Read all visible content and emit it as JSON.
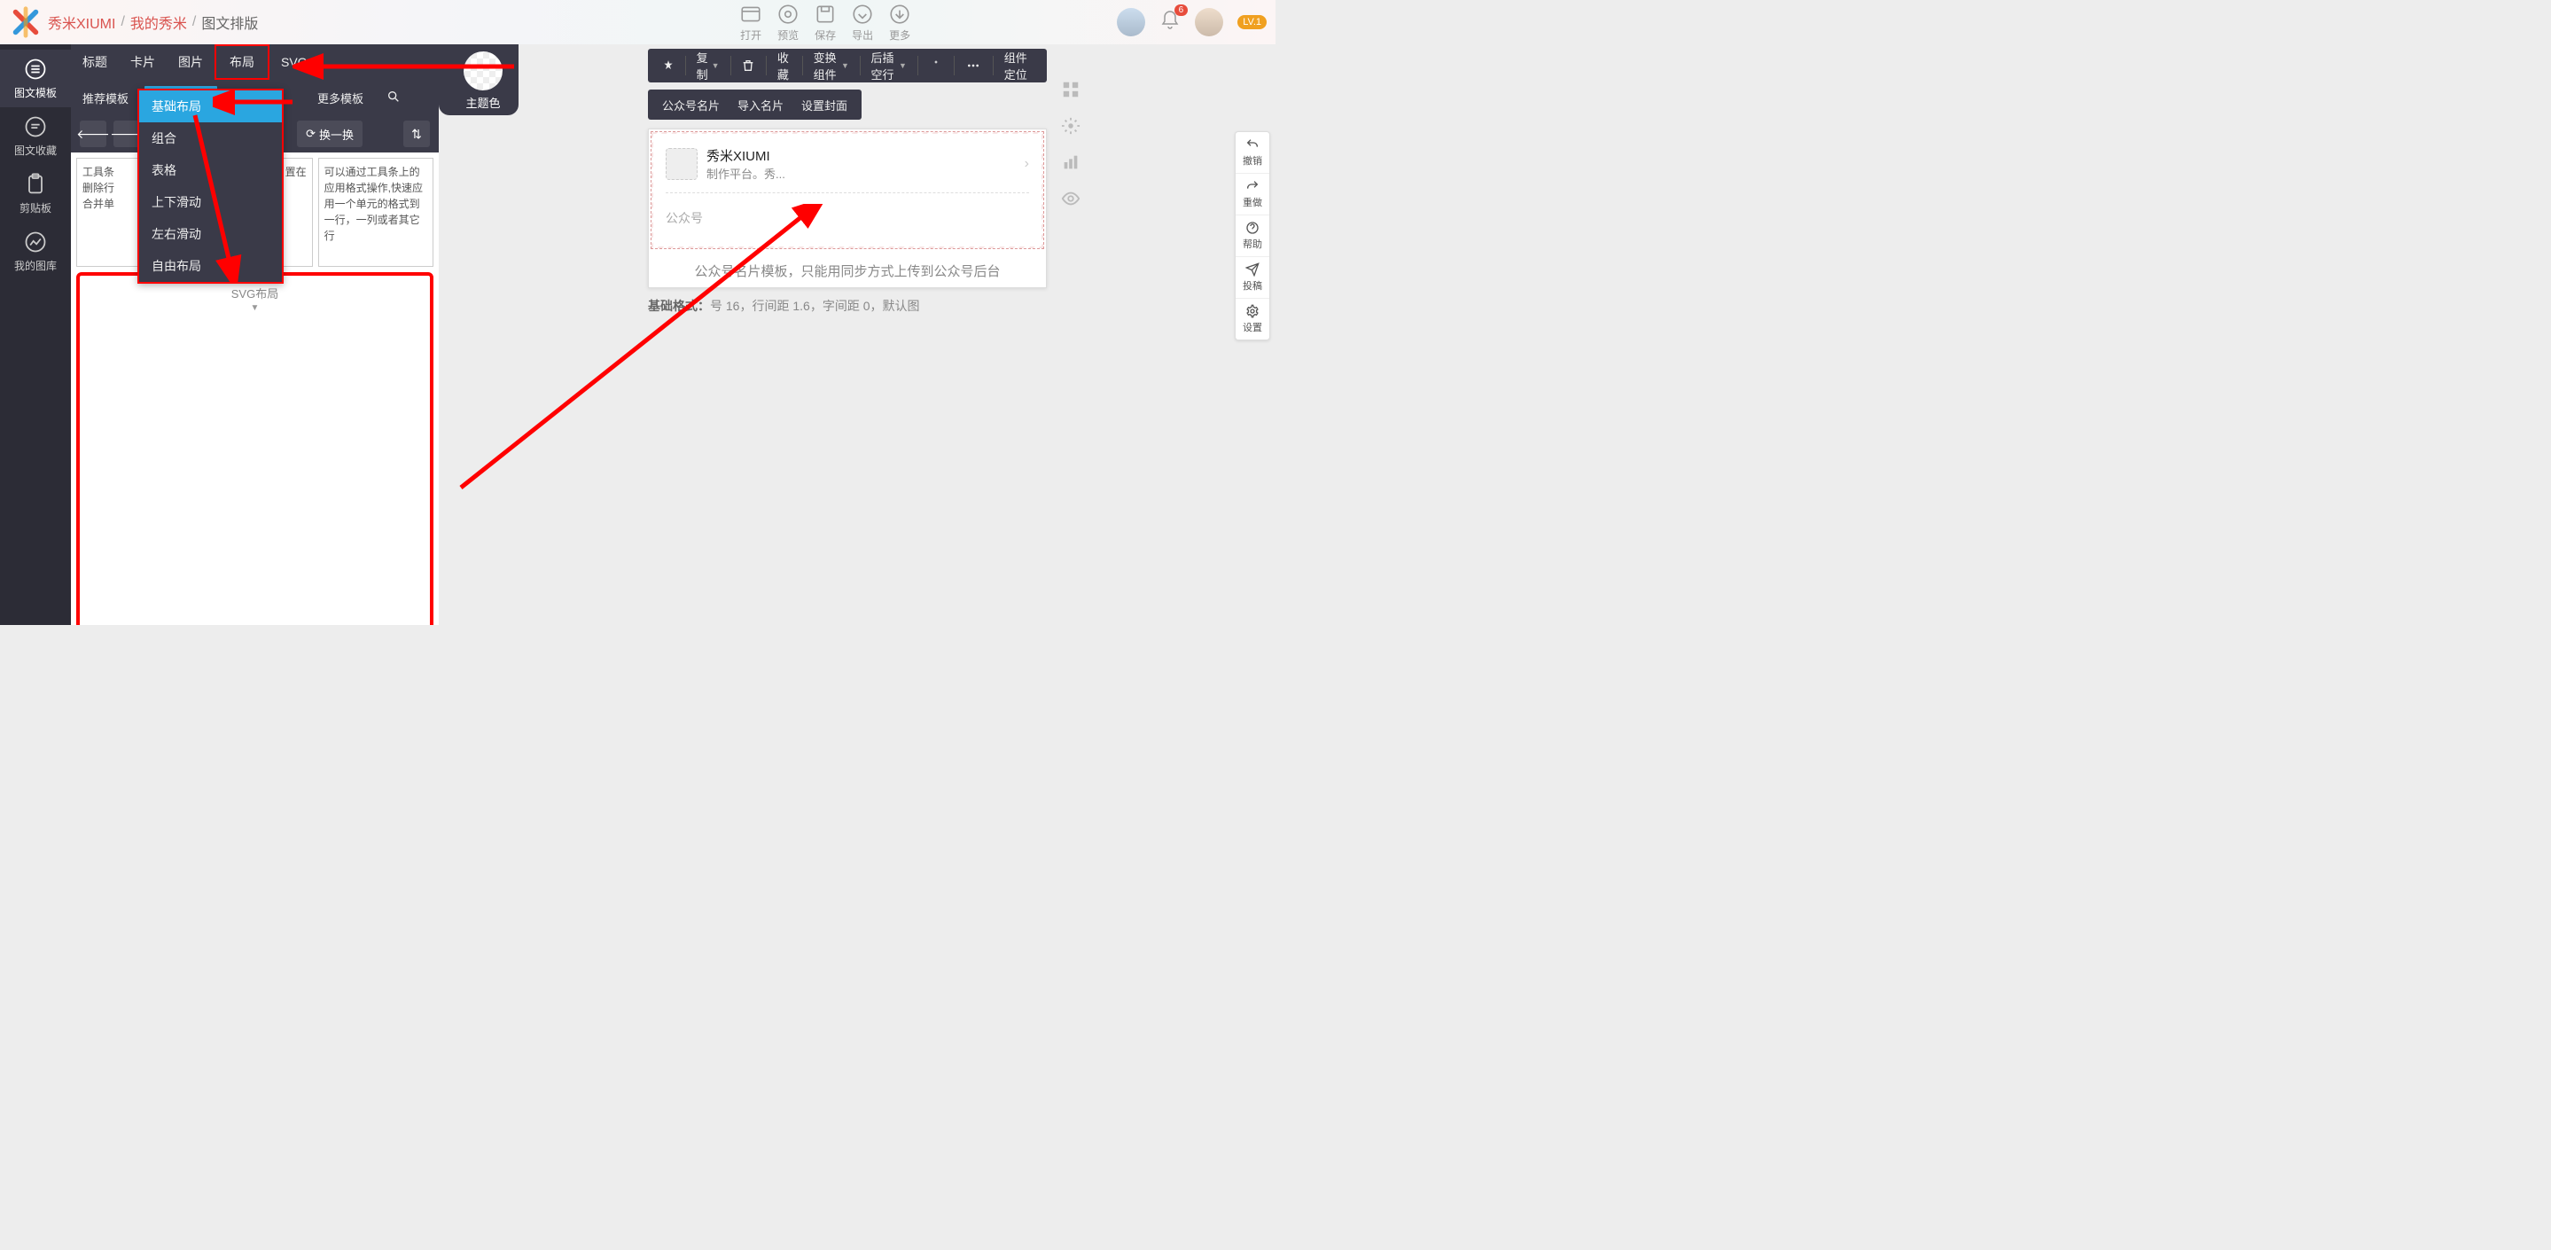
{
  "header": {
    "breadcrumb": [
      "秀米XIUMI",
      "我的秀米",
      "图文排版"
    ],
    "actions": [
      {
        "label": "打开"
      },
      {
        "label": "预览"
      },
      {
        "label": "保存"
      },
      {
        "label": "导出"
      },
      {
        "label": "更多"
      }
    ],
    "badge_count": "6",
    "level": "LV.1"
  },
  "sidebar": [
    {
      "label": "图文模板",
      "active": true
    },
    {
      "label": "图文收藏"
    },
    {
      "label": "剪贴板"
    },
    {
      "label": "我的图库"
    }
  ],
  "tabs_row1": [
    "标题",
    "卡片",
    "图片",
    "布局",
    "SVG"
  ],
  "tabs_row2": [
    "推荐模板",
    "基础布局",
    "更多模板"
  ],
  "third_bar": {
    "refresh": "换一换"
  },
  "theme_label": "主题色",
  "dropdown": [
    "基础布局",
    "组合",
    "表格",
    "上下滑动",
    "左右滑动",
    "自由布局"
  ],
  "tpl_cards": {
    "c1_l1": "工具条",
    "c1_l2": "删除行",
    "c1_l3": "合并单",
    "c2_l1": "置在",
    "c3": "可以通过工具条上的应用格式操作,快速应用一个单元的格式到一行，一列或者其它行"
  },
  "svg_layout_label": "SVG布局",
  "float_toolbar": [
    "复制",
    "收藏",
    "变换组件",
    "后插空行",
    "组件定位"
  ],
  "float_toolbar2": [
    "公众号名片",
    "导入名片",
    "设置封面"
  ],
  "card": {
    "title": "秀米XIUMI",
    "subtitle": "制作平台。秀...",
    "placeholder": "公众号"
  },
  "card_hint": "公众号名片模板，只能用同步方式上传到公众号后台",
  "footer": {
    "prefix": "基础格式：",
    "text": "号 16，行间距 1.6，字间距 0，默认图"
  },
  "right_pills": [
    "撤销",
    "重做",
    "帮助",
    "投稿",
    "设置"
  ]
}
